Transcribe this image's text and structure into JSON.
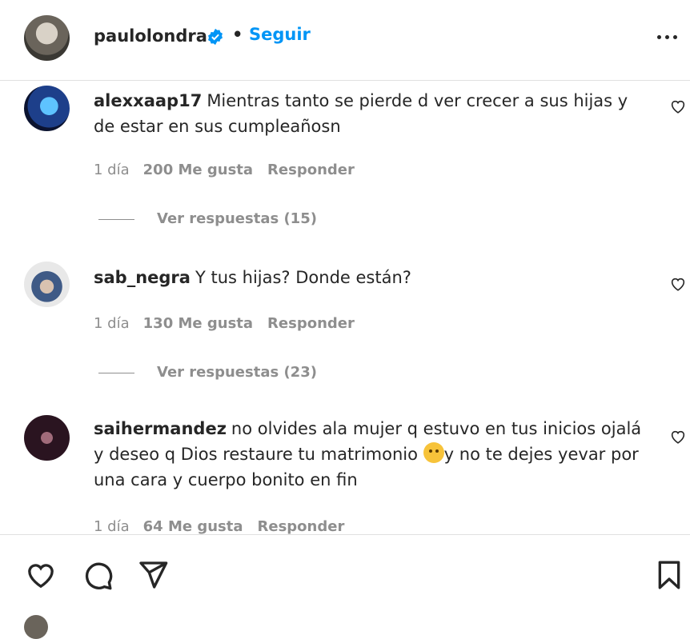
{
  "post": {
    "username": "paulolondra",
    "separator": "•",
    "follow_label": "Seguir"
  },
  "comments": [
    {
      "username": "alexxaap17",
      "text": "Mientras tanto se pierde d ver crecer a sus hijas y de estar en sus cumpleañosn",
      "time": "1 día",
      "likes": "200 Me gusta",
      "reply_label": "Responder",
      "view_replies": "Ver respuestas (15)"
    },
    {
      "username": "sab_negra",
      "text": "Y tus hijas? Donde están?",
      "time": "1 día",
      "likes": "130 Me gusta",
      "reply_label": "Responder",
      "view_replies": "Ver respuestas (23)"
    },
    {
      "username": "saihermandez",
      "text_before_emoji": "no olvides ala mujer q estuvo en tus inicios ojalá y deseo q Dios restaure tu matrimonio ",
      "text_after_emoji": "y no te dejes yevar por una cara y cuerpo bonito en fin",
      "time": "1 día",
      "likes": "64 Me gusta",
      "reply_label": "Responder"
    }
  ],
  "icons": {
    "header": [
      "verified-badge-icon",
      "more-options-icon"
    ],
    "comment": "heart-outline-icon",
    "footer": [
      "like-icon",
      "comment-icon",
      "share-icon",
      "bookmark-icon"
    ]
  },
  "colors": {
    "accent": "#0095f6",
    "muted": "#8e8e8e",
    "text": "#262626"
  }
}
